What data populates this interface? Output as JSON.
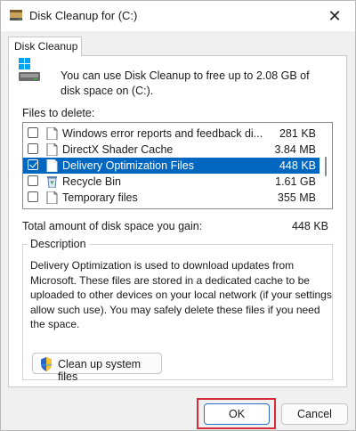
{
  "window": {
    "title": "Disk Cleanup for  (C:)",
    "close_glyph": "✕"
  },
  "tabs": [
    {
      "label": "Disk Cleanup",
      "active": true
    }
  ],
  "intro": {
    "text": "You can use Disk Cleanup to free up to 2.08 GB of disk space on  (C:)."
  },
  "files": {
    "label": "Files to delete:",
    "items": [
      {
        "name": "Windows error reports and feedback di...",
        "size": "281 KB",
        "checked": false,
        "selected": false,
        "icon": "file-icon"
      },
      {
        "name": "DirectX Shader Cache",
        "size": "3.84 MB",
        "checked": false,
        "selected": false,
        "icon": "file-icon"
      },
      {
        "name": "Delivery Optimization Files",
        "size": "448 KB",
        "checked": true,
        "selected": true,
        "icon": "file-icon"
      },
      {
        "name": "Recycle Bin",
        "size": "1.61 GB",
        "checked": false,
        "selected": false,
        "icon": "recycle-bin-icon"
      },
      {
        "name": "Temporary files",
        "size": "355 MB",
        "checked": false,
        "selected": false,
        "icon": "file-icon"
      }
    ]
  },
  "total": {
    "label": "Total amount of disk space you gain:",
    "value": "448 KB"
  },
  "description": {
    "legend": "Description",
    "text": "Delivery Optimization is used to download updates from Microsoft. These files are stored in a dedicated cache to be uploaded to other devices on your local network (if your settings allow such use). You may safely delete these files if you need the space."
  },
  "buttons": {
    "cleanup": "Clean up system files",
    "ok": "OK",
    "cancel": "Cancel"
  },
  "colors": {
    "selection": "#0067c0",
    "highlight_box": "#d42a3a",
    "ok_border": "#2a70c8"
  }
}
